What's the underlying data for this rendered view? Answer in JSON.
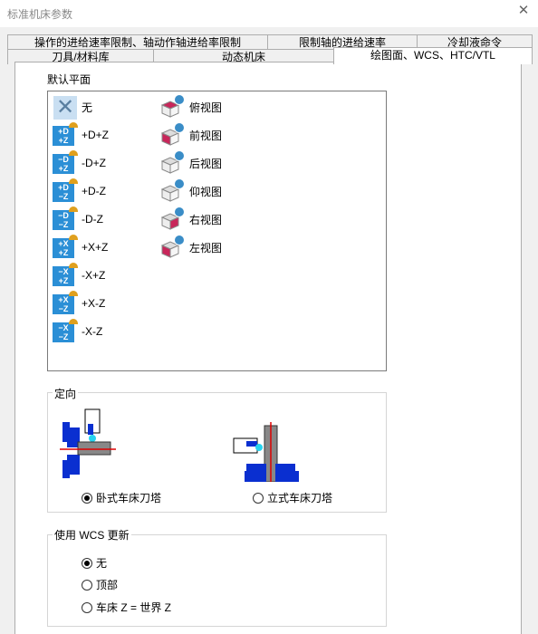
{
  "window": {
    "title": "标准机床参数",
    "close_glyph": "✕"
  },
  "tabs_row1": [
    "操作的进给速率限制、轴动作轴进给率限制",
    "限制轴的进给速率",
    "冷却液命令"
  ],
  "tabs_row2": [
    "刀具/材料库",
    "动态机床",
    "绘图面、WCS、HTC/VTL"
  ],
  "active_tab": "绘图面、WCS、HTC/VTL",
  "default_plane": {
    "label": "默认平面",
    "planes": [
      {
        "label": "无",
        "icon": "none-x-icon",
        "badge": ""
      },
      {
        "label": "+D+Z",
        "icon": "plane-plus-d-plus-z-icon",
        "badge": "+D\n+Z"
      },
      {
        "label": "-D+Z",
        "icon": "plane-minus-d-plus-z-icon",
        "badge": "−D\n+Z"
      },
      {
        "label": "+D-Z",
        "icon": "plane-plus-d-minus-z-icon",
        "badge": "+D\n−Z"
      },
      {
        "label": "-D-Z",
        "icon": "plane-minus-d-minus-z-icon",
        "badge": "−D\n−Z"
      },
      {
        "label": "+X+Z",
        "icon": "plane-plus-x-plus-z-icon",
        "badge": "+X\n+Z"
      },
      {
        "label": "-X+Z",
        "icon": "plane-minus-x-plus-z-icon",
        "badge": "−X\n+Z"
      },
      {
        "label": "+X-Z",
        "icon": "plane-plus-x-minus-z-icon",
        "badge": "+X\n−Z"
      },
      {
        "label": "-X-Z",
        "icon": "plane-minus-x-minus-z-icon",
        "badge": "−X\n−Z"
      }
    ],
    "views": [
      {
        "label": "俯视图",
        "icon": "top-view-icon"
      },
      {
        "label": "前视图",
        "icon": "front-view-icon"
      },
      {
        "label": "后视图",
        "icon": "back-view-icon"
      },
      {
        "label": "仰视图",
        "icon": "bottom-view-icon"
      },
      {
        "label": "右视图",
        "icon": "right-view-icon"
      },
      {
        "label": "左视图",
        "icon": "left-view-icon"
      }
    ]
  },
  "orientation": {
    "label": "定向",
    "options": [
      {
        "label": "卧式车床刀塔",
        "selected": true
      },
      {
        "label": "立式车床刀塔",
        "selected": false
      }
    ]
  },
  "wcs_update": {
    "label": "使用 WCS 更新",
    "options": [
      {
        "label": "无",
        "selected": true
      },
      {
        "label": "顶部",
        "selected": false
      },
      {
        "label": "车床 Z = 世界 Z",
        "selected": false
      }
    ]
  },
  "colors": {
    "accent_blue": "#2b8fd6",
    "badge_gold": "#e0a01e",
    "face_magenta": "#c8265a",
    "machine_blue": "#0a2fd0"
  }
}
